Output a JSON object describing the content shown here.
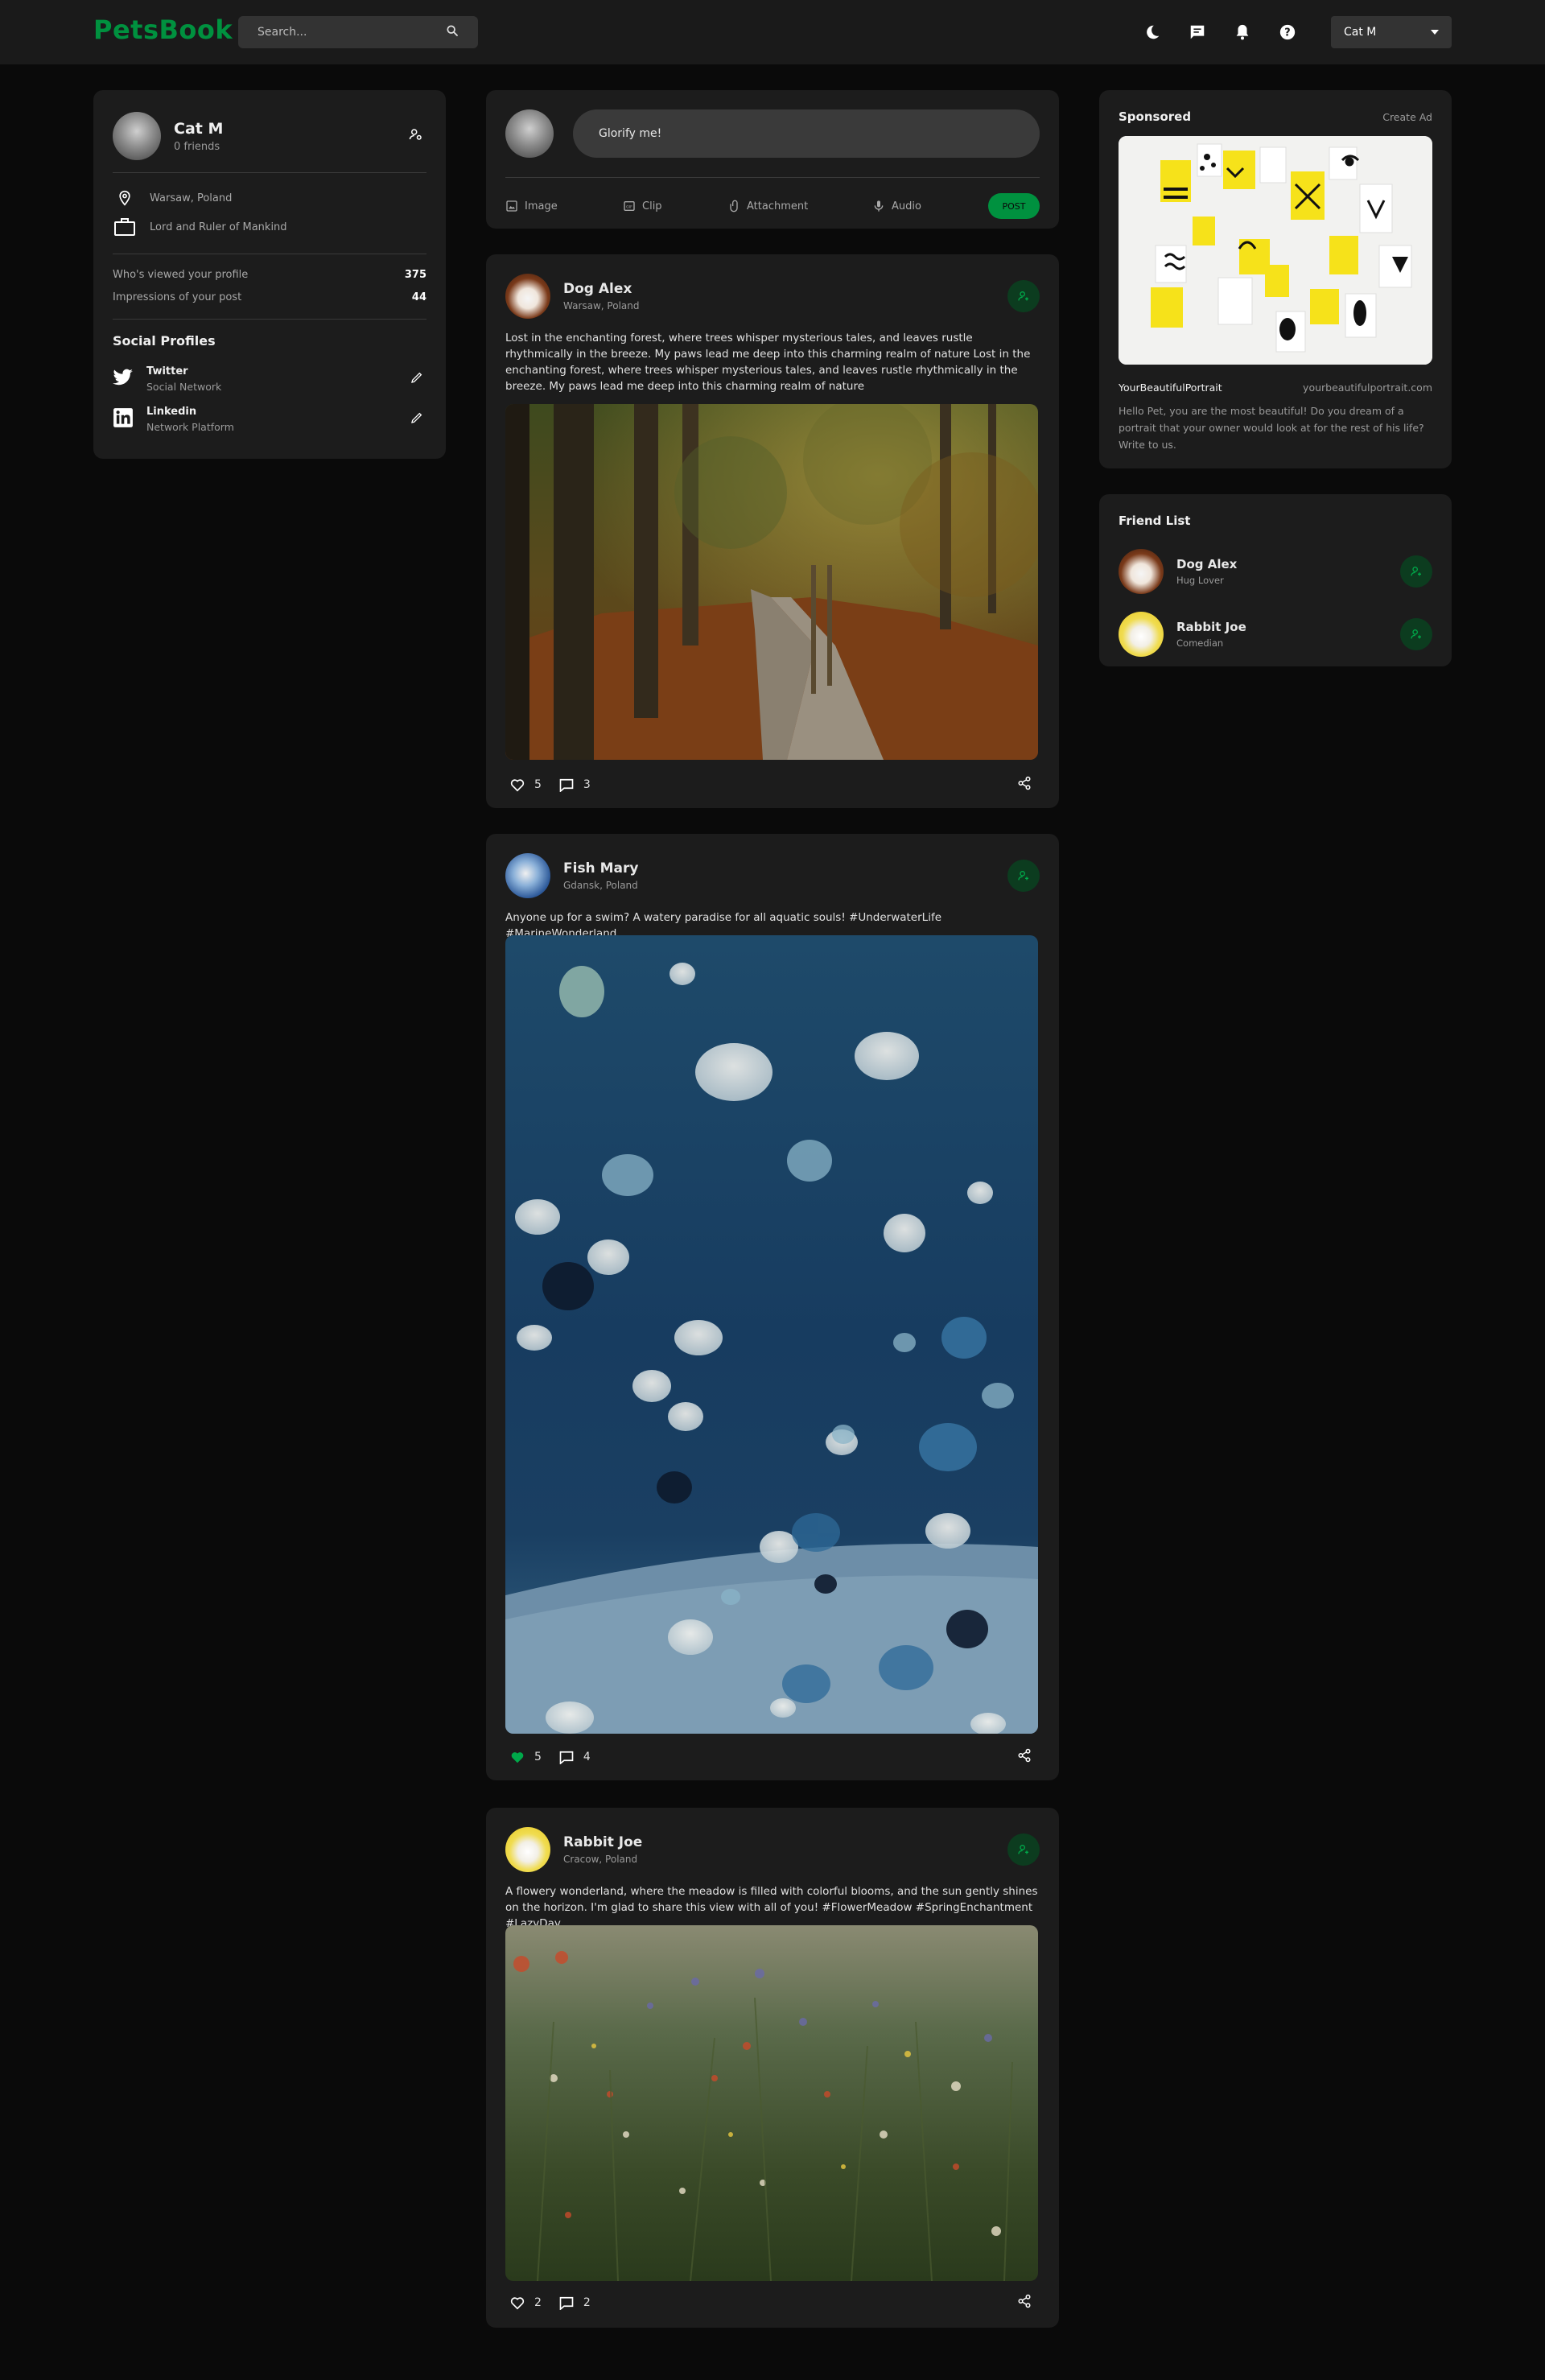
{
  "app": {
    "logo": "PetsBook"
  },
  "search": {
    "placeholder": "Search..."
  },
  "user_menu": {
    "selected": "Cat M"
  },
  "profile": {
    "name": "Cat M",
    "friends": "0 friends",
    "location": "Warsaw, Poland",
    "occupation": "Lord and Ruler of Mankind",
    "stats": [
      {
        "label": "Who's viewed your profile",
        "value": "375"
      },
      {
        "label": "Impressions of your post",
        "value": "44"
      }
    ],
    "social_title": "Social Profiles",
    "social": [
      {
        "name": "Twitter",
        "sub": "Social Network"
      },
      {
        "name": "Linkedin",
        "sub": "Network Platform"
      }
    ]
  },
  "composer": {
    "placeholder": "Glorify me!",
    "actions": [
      "Image",
      "Clip",
      "Attachment",
      "Audio"
    ],
    "post_label": "POST"
  },
  "posts": [
    {
      "name": "Dog Alex",
      "location": "Warsaw, Poland",
      "text": "Lost in the enchanting forest, where trees whisper mysterious tales, and leaves rustle rhythmically in the breeze. My paws lead me deep into this charming realm of nature Lost in the enchanting forest, where trees whisper mysterious tales, and leaves rustle rhythmically in the breeze. My paws lead me deep into this charming realm of nature",
      "likes": "5",
      "comments": "3",
      "liked": false
    },
    {
      "name": "Fish Mary",
      "location": "Gdansk, Poland",
      "text": "Anyone up for a swim? A watery paradise for all aquatic souls! #UnderwaterLife #MarineWonderland",
      "likes": "5",
      "comments": "4",
      "liked": true
    },
    {
      "name": "Rabbit Joe",
      "location": "Cracow, Poland",
      "text": "A flowery wonderland, where the meadow is filled with colorful blooms, and the sun gently shines on the horizon. I'm glad to share this view with all of you! #FlowerMeadow #SpringEnchantment #LazyDay",
      "likes": "2",
      "comments": "2",
      "liked": false
    }
  ],
  "sponsored": {
    "title": "Sponsored",
    "create": "Create Ad",
    "brand": "YourBeautifulPortrait",
    "url": "yourbeautifulportrait.com",
    "description": "Hello Pet, you are the most beautiful! Do you dream of a portrait that your owner would look at for the rest of his life? Write to us."
  },
  "friends": {
    "title": "Friend List",
    "items": [
      {
        "name": "Dog Alex",
        "sub": "Hug Lover"
      },
      {
        "name": "Rabbit Joe",
        "sub": "Comedian"
      }
    ]
  },
  "colors": {
    "brand": "#00913f",
    "bg": "#0a0a0a",
    "card": "#1c1c1c",
    "nav": "#1a1a1a"
  }
}
